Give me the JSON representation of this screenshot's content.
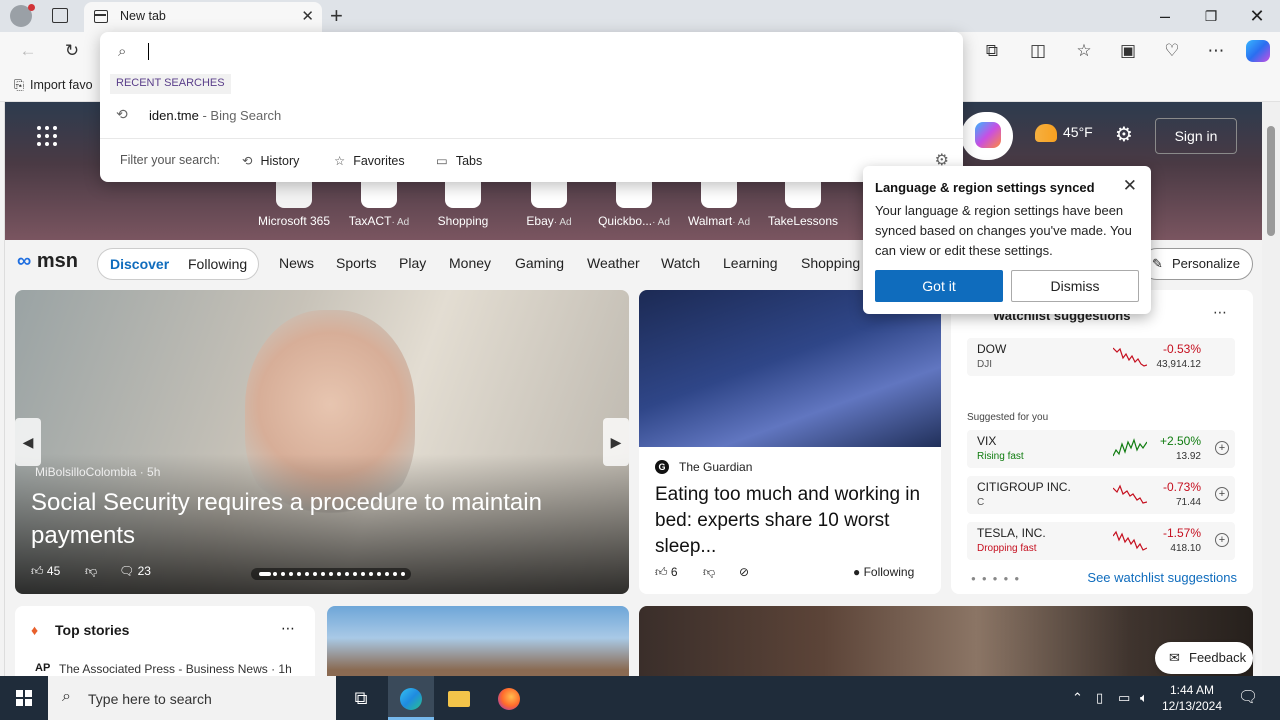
{
  "browser": {
    "tab_title": "New tab",
    "favorites_bar": {
      "import_label": "Import favo"
    }
  },
  "omnibox": {
    "recent_label": "RECENT SEARCHES",
    "recent_query": "iden.tme",
    "recent_suffix": " - Bing Search",
    "filter_label": "Filter your search:",
    "filters": [
      "History",
      "Favorites",
      "Tabs"
    ]
  },
  "msn": {
    "quick_links": [
      {
        "label": "Microsoft 365",
        "ad": ""
      },
      {
        "label": "TaxACT",
        "ad": "· Ad"
      },
      {
        "label": "Shopping",
        "ad": ""
      },
      {
        "label": "Ebay",
        "ad": "· Ad"
      },
      {
        "label": "Quickbo...",
        "ad": "· Ad"
      },
      {
        "label": "Walmart",
        "ad": "· Ad"
      },
      {
        "label": "TakeLessons",
        "ad": ""
      }
    ],
    "weather_temp": "45°F",
    "sign_in": "Sign in",
    "logo": "msn",
    "nav": {
      "discover": "Discover",
      "following": "Following",
      "items": [
        "News",
        "Sports",
        "Play",
        "Money",
        "Gaming",
        "Weather",
        "Watch",
        "Learning",
        "Shopping"
      ],
      "personalize": "Personalize"
    },
    "main_story": {
      "source": "MiBolsilloColombia · 5h",
      "headline": "Social Security requires a procedure to maintain payments",
      "likes": "45",
      "comments": "23"
    },
    "guardian_story": {
      "source": "The Guardian",
      "headline": "Eating too much and working in bed: experts share 10 worst sleep...",
      "likes": "6",
      "following": "Following"
    },
    "watchlist": {
      "title": "Watchlist suggestions",
      "suggested_label": "Suggested for you",
      "see_more": "See watchlist suggestions",
      "stocks": [
        {
          "name": "DOW",
          "sub": "DJI",
          "pct": "-0.53%",
          "price": "43,914.12",
          "trend": "down",
          "sub_status": ""
        },
        {
          "name": "VIX",
          "sub": "Rising fast",
          "pct": "+2.50%",
          "price": "13.92",
          "trend": "up",
          "sub_status": "grn"
        },
        {
          "name": "CITIGROUP INC.",
          "sub": "C",
          "pct": "-0.73%",
          "price": "71.44",
          "trend": "down",
          "sub_status": ""
        },
        {
          "name": "TESLA, INC.",
          "sub": "Dropping fast",
          "pct": "-1.57%",
          "price": "418.10",
          "trend": "down",
          "sub_status": "red"
        }
      ]
    },
    "top_stories": {
      "title": "Top stories",
      "first_source": "The Associated Press - Business News · 1h"
    },
    "feedback": "Feedback"
  },
  "popup": {
    "title": "Language & region settings synced",
    "body": "Your language & region settings have been synced based on changes you've made. You can view or edit these settings.",
    "got_it": "Got it",
    "dismiss": "Dismiss"
  },
  "taskbar": {
    "search_placeholder": "Type here to search",
    "time": "1:44 AM",
    "date": "12/13/2024"
  },
  "colors": {
    "accent": "#0f6cbd",
    "negative": "#c50f1f",
    "positive": "#107c10"
  }
}
